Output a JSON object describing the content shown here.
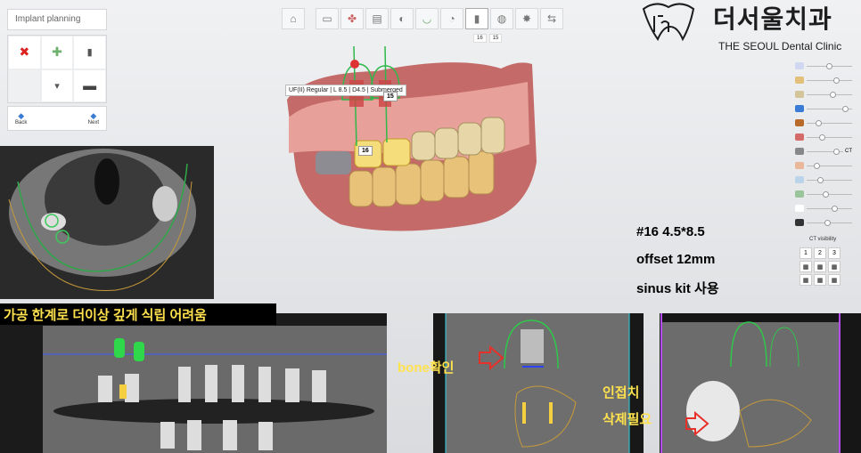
{
  "panel": {
    "title": "Implant planning",
    "back_label": "Back",
    "next_label": "Next"
  },
  "toolbar": {
    "icons": [
      "home-icon",
      "fixture-icon",
      "bone-icon",
      "section-icon",
      "tooth-icon",
      "arch-icon",
      "crown-icon",
      "implant-icon",
      "abutment-icon",
      "settings-icon",
      "export-icon"
    ],
    "tooth_numbers": [
      "16",
      "15"
    ]
  },
  "clinic": {
    "name_kr": "더서울치과",
    "name_en": "THE SEOUL Dental Clinic"
  },
  "implant": {
    "label": "UF(II) Regular | L 8.5 | D4.5 | Submerged",
    "tags": [
      "16",
      "15"
    ]
  },
  "notes": {
    "line1": "#16 4.5*8.5",
    "line2": "offset 12mm",
    "line3": "sinus kit 사용"
  },
  "right_panel": {
    "ct_label": "CT",
    "ct_visibility": "CT visibility",
    "view_numbers": [
      "1",
      "2",
      "3"
    ]
  },
  "bottom": {
    "banner": "가공 한계로 더이상 깊게 식립 어려움",
    "bone_label": "bone확인",
    "adjacent_line1": "인접치",
    "adjacent_line2": "삭제필요"
  },
  "colors": {
    "implant_green": "#2fb84a",
    "arrow_red": "#e8302a",
    "note_yellow": "#ffe24d"
  }
}
